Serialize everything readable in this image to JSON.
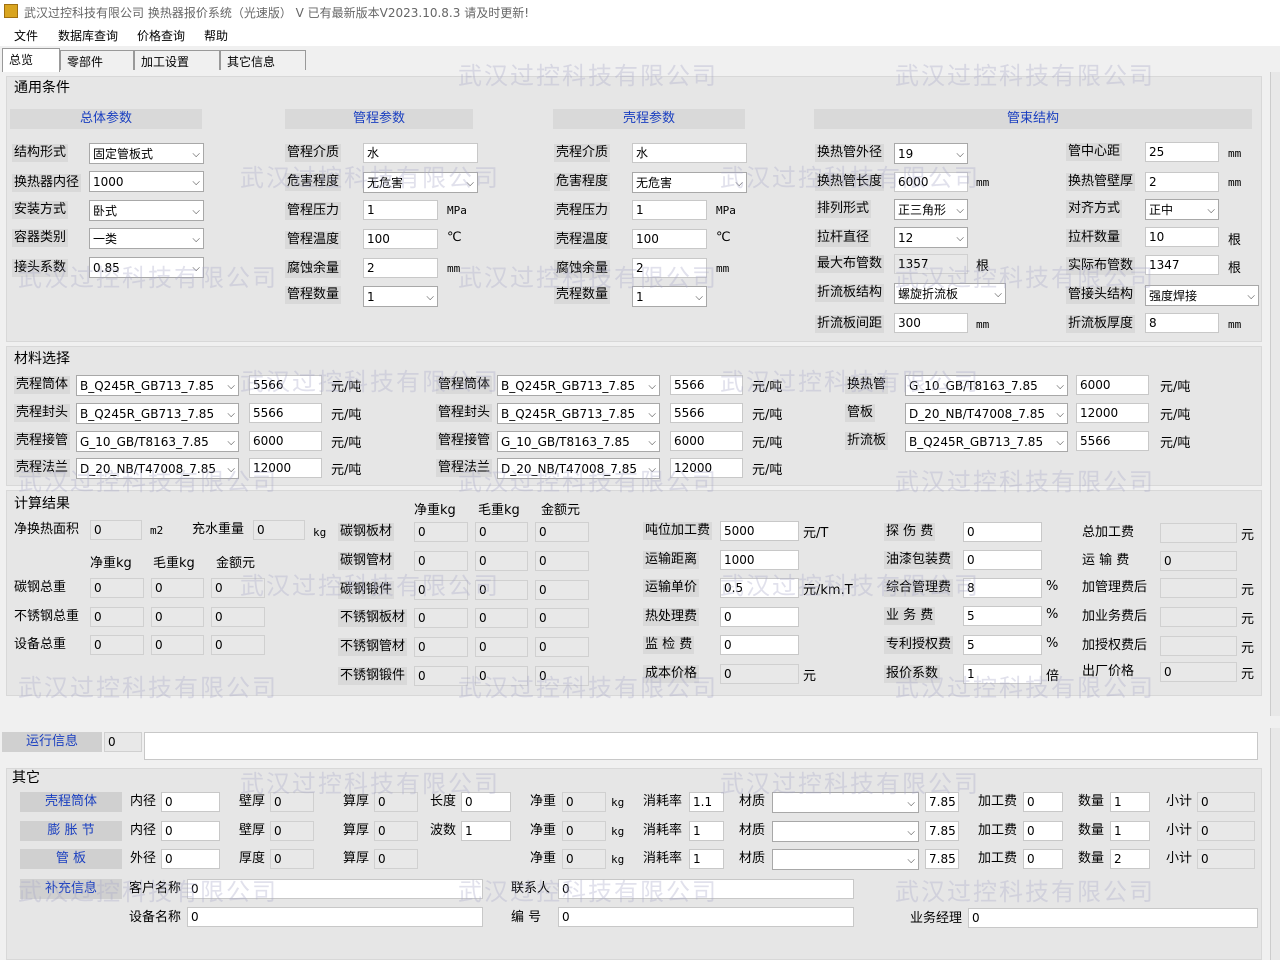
{
  "window": {
    "title": "武汉过控科技有限公司   换热器报价系统（光速版）   V     已有最新版本V2023.10.8.3  请及时更新!"
  },
  "menu": [
    "文件",
    "数据库查询",
    "价格查询",
    "帮助"
  ],
  "tabs": [
    "总览",
    "零部件",
    "加工设置",
    "其它信息"
  ],
  "watermark": "武汉过控科技有限公司",
  "general": {
    "title": "通用条件",
    "headers": [
      "总体参数",
      "管程参数",
      "壳程参数",
      "管束结构"
    ],
    "overall": [
      [
        "结构形式",
        "固定管板式"
      ],
      [
        "换热器内径",
        "1000"
      ],
      [
        "安装方式",
        "卧式"
      ],
      [
        "容器类别",
        "一类"
      ],
      [
        "接头系数",
        "0.85"
      ]
    ],
    "tube": [
      [
        "管程介质",
        "水"
      ],
      [
        "危害程度",
        "无危害"
      ],
      [
        "管程压力",
        "1",
        "MPa"
      ],
      [
        "管程温度",
        "100",
        "℃"
      ],
      [
        "腐蚀余量",
        "2",
        "mm"
      ],
      [
        "管程数量",
        "1"
      ]
    ],
    "shell": [
      [
        "壳程介质",
        "水"
      ],
      [
        "危害程度",
        "无危害"
      ],
      [
        "壳程压力",
        "1",
        "MPa"
      ],
      [
        "壳程温度",
        "100",
        "℃"
      ],
      [
        "腐蚀余量",
        "2",
        "mm"
      ],
      [
        "壳程数量",
        "1"
      ]
    ],
    "bundle_left": [
      [
        "换热管外径",
        "19",
        ""
      ],
      [
        "换热管长度",
        "6000",
        "mm"
      ],
      [
        "排列形式",
        "正三角形",
        ""
      ],
      [
        "拉杆直径",
        "12",
        ""
      ],
      [
        "最大布管数",
        "1357",
        "根"
      ],
      [
        "折流板结构",
        "螺旋折流板",
        ""
      ],
      [
        "折流板间距",
        "300",
        "mm"
      ]
    ],
    "bundle_right": [
      [
        "管中心距",
        "25",
        "mm"
      ],
      [
        "换热管壁厚",
        "2",
        "mm"
      ],
      [
        "对齐方式",
        "正中",
        ""
      ],
      [
        "拉杆数量",
        "10",
        "根"
      ],
      [
        "实际布管数",
        "1347",
        "根"
      ],
      [
        "管接头结构",
        "强度焊接",
        ""
      ],
      [
        "折流板厚度",
        "8",
        "mm"
      ]
    ]
  },
  "materials": {
    "title": "材料选择",
    "col1": [
      [
        "壳程筒体",
        "B_Q245R_GB713_7.85",
        "5566",
        "元/吨"
      ],
      [
        "壳程封头",
        "B_Q245R_GB713_7.85",
        "5566",
        "元/吨"
      ],
      [
        "壳程接管",
        "G_10_GB/T8163_7.85",
        "6000",
        "元/吨"
      ],
      [
        "壳程法兰",
        "D_20_NB/T47008_7.85",
        "12000",
        "元/吨"
      ]
    ],
    "col2": [
      [
        "管程筒体",
        "B_Q245R_GB713_7.85",
        "5566",
        "元/吨"
      ],
      [
        "管程封头",
        "B_Q245R_GB713_7.85",
        "5566",
        "元/吨"
      ],
      [
        "管程接管",
        "G_10_GB/T8163_7.85",
        "6000",
        "元/吨"
      ],
      [
        "管程法兰",
        "D_20_NB/T47008_7.85",
        "12000",
        "元/吨"
      ]
    ],
    "col3": [
      [
        "换热管",
        "G_10_GB/T8163_7.85",
        "6000",
        "元/吨"
      ],
      [
        "管板",
        "D_20_NB/T47008_7.85",
        "12000",
        "元/吨"
      ],
      [
        "折流板",
        "B_Q245R_GB713_7.85",
        "5566",
        "元/吨"
      ]
    ]
  },
  "calc": {
    "title": "计算结果",
    "area_label": "净换热面积",
    "area": "0",
    "area_unit": "m2",
    "fill_label": "充水重量",
    "fill": "0",
    "fill_unit": "kg",
    "cols": [
      "净重kg",
      "毛重kg",
      "金额元"
    ],
    "totals": [
      [
        "碳钢总重",
        "0",
        "0",
        "0"
      ],
      [
        "不锈钢总重",
        "0",
        "0",
        "0"
      ],
      [
        "设备总重",
        "0",
        "0",
        "0"
      ]
    ],
    "items": [
      [
        "碳钢板材",
        "0",
        "0",
        "0"
      ],
      [
        "碳钢管材",
        "0",
        "0",
        "0"
      ],
      [
        "碳钢锻件",
        "0",
        "0",
        "0"
      ],
      [
        "不锈钢板材",
        "0",
        "0",
        "0"
      ],
      [
        "不锈钢管材",
        "0",
        "0",
        "0"
      ],
      [
        "不锈钢锻件",
        "0",
        "0",
        "0"
      ]
    ],
    "costs": [
      [
        "吨位加工费",
        "5000",
        "元/T"
      ],
      [
        "运输距离",
        "1000",
        ""
      ],
      [
        "运输单价",
        "0.5",
        "元/km.T"
      ],
      [
        "热处理费",
        "0",
        ""
      ],
      [
        "监  检  费",
        "0",
        ""
      ],
      [
        "成本价格",
        "0",
        "元"
      ]
    ],
    "fees": [
      [
        "探  伤  费",
        "0",
        ""
      ],
      [
        "油漆包装费",
        "0",
        ""
      ],
      [
        "综合管理费",
        "8",
        "%"
      ],
      [
        "业  务  费",
        "5",
        "%"
      ],
      [
        "专利授权费",
        "5",
        "%"
      ],
      [
        "报价系数",
        "1",
        "倍"
      ]
    ],
    "summary": [
      [
        "总加工费",
        "",
        "元"
      ],
      [
        "运  输  费",
        "0",
        ""
      ],
      [
        "加管理费后",
        "",
        "元"
      ],
      [
        "加业务费后",
        "",
        "元"
      ],
      [
        "加授权费后",
        "",
        "元"
      ],
      [
        "出厂价格",
        "0",
        "元"
      ]
    ]
  },
  "run": {
    "label": "运行信息",
    "value": "0",
    "message": ""
  },
  "other": {
    "title": "其它",
    "rows": [
      {
        "name": "壳程筒体",
        "f1": "内径",
        "v1": "0",
        "f2": "壁厚",
        "v2": "0",
        "f3": "算厚",
        "v3": "0",
        "f4": "长度",
        "v4": "0",
        "wt": "0",
        "loss": "1.1",
        "mat": "",
        "den": "7.85",
        "fee": "0",
        "qty": "1",
        "sub": "0"
      },
      {
        "name": "膨 胀 节",
        "f1": "内径",
        "v1": "0",
        "f2": "壁厚",
        "v2": "0",
        "f3": "算厚",
        "v3": "0",
        "f4": "波数",
        "v4": "1",
        "wt": "0",
        "loss": "1",
        "mat": "",
        "den": "7.85",
        "fee": "0",
        "qty": "1",
        "sub": "0"
      },
      {
        "name": "管    板",
        "f1": "外径",
        "v1": "0",
        "f2": "厚度",
        "v2": "0",
        "f3": "算厚",
        "v3": "0",
        "f4": "",
        "v4": "",
        "wt": "0",
        "loss": "1",
        "mat": "",
        "den": "7.85",
        "fee": "0",
        "qty": "2",
        "sub": "0"
      }
    ],
    "labels": {
      "net": "净重",
      "kg": "kg",
      "loss": "消耗率",
      "mat": "材质",
      "fee": "加工费",
      "qty": "数量",
      "sub": "小计"
    },
    "supp": "补充信息",
    "customer_label": "客户名称",
    "customer": "0",
    "contact_label": "联系人",
    "contact": "0",
    "device_label": "设备名称",
    "device": "0",
    "number_label": "编    号",
    "number": "0",
    "manager_label": "业务经理",
    "manager": "0"
  }
}
